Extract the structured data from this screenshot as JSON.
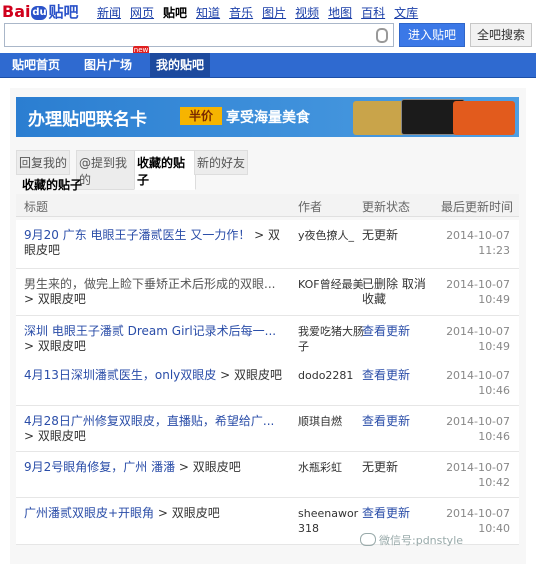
{
  "topnav": {
    "links": [
      "新闻",
      "网页",
      "贴吧",
      "知道",
      "音乐",
      "图片",
      "视频",
      "地图",
      "百科",
      "文库"
    ],
    "current": "贴吧"
  },
  "search": {
    "value": "",
    "enter_label": "进入贴吧",
    "search_all_label": "全吧搜索"
  },
  "tabs": [
    "贴吧首页",
    "图片广场",
    "我的贴吧"
  ],
  "new_flag": "new",
  "banner": {
    "text1": "办理贴吧联名卡",
    "badge": "半价",
    "text2": "享受海量美食"
  },
  "subtabs": [
    "回复我的",
    "@提到我的",
    "收藏的贴子",
    "新的好友"
  ],
  "section_title": "收藏的贴子",
  "columns": {
    "title": "标题",
    "author": "作者",
    "status": "更新状态",
    "time": "最后更新时间"
  },
  "rows": [
    {
      "title": "9月20 广东 电眼王子潘贰医生 又一力作！",
      "bar": "双眼皮吧",
      "author": "y夜色撩人_",
      "status": "无更新",
      "status_link": false,
      "time": "2014-10-07 11:23"
    },
    {
      "title": "男生来的，做完上睑下垂矫正术后形成的双眼...",
      "bar": "双眼皮吧",
      "author": "KOF曾经最美",
      "status": "已删除 取消收藏",
      "status_link": false,
      "time": "2014-10-07 10:49"
    },
    {
      "title": "深圳 电眼王子潘贰 Dream Girl记录术后每一...",
      "bar": "双眼皮吧",
      "author": "我爱吃猪大肠子",
      "status": "查看更新",
      "status_link": true,
      "time": "2014-10-07 10:49"
    },
    {
      "title": "4月13日深圳潘贰医生，only双眼皮",
      "bar": "双眼皮吧",
      "author": "dodo2281",
      "status": "查看更新",
      "status_link": true,
      "time": "2014-10-07 10:46"
    },
    {
      "title": "4月28日广州修复双眼皮，直播贴，希望给广...",
      "bar": "双眼皮吧",
      "author": "顺琪自燃",
      "status": "查看更新",
      "status_link": true,
      "time": "2014-10-07 10:46"
    },
    {
      "title": "9月2号眼角修复，广州 潘潘",
      "bar": "双眼皮吧",
      "author": "水瓶彩虹",
      "status": "无更新",
      "status_link": false,
      "time": "2014-10-07 10:42"
    },
    {
      "title": "广州潘贰双眼皮+开眼角",
      "bar": "双眼皮吧",
      "author": "sheenawor318",
      "status": "查看更新",
      "status_link": true,
      "time": "2014-10-07 10:40"
    }
  ],
  "watermark": "微信号:pdnstyle"
}
